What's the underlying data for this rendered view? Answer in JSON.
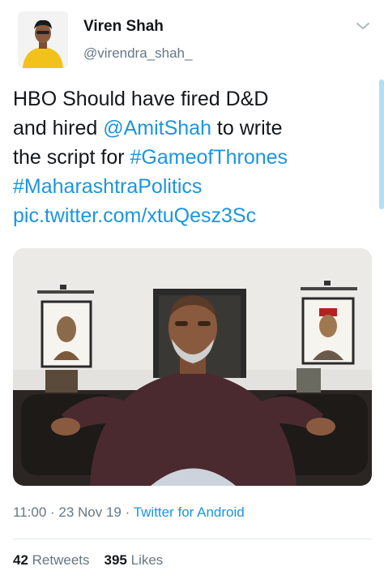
{
  "author": {
    "name": "Viren Shah",
    "handle": "@virendra_shah_"
  },
  "tweet": {
    "line1": "HBO Should have fired D&D",
    "line2_prefix": "and hired ",
    "mention": "@AmitShah",
    "line2_suffix": " to write",
    "line3_prefix": "the script for ",
    "hashtag1": "#GameofThrones",
    "hashtag2": "#MaharashtraPolitics",
    "pic_link": "pic.twitter.com/xtuQesz3Sc"
  },
  "meta": {
    "time": "11:00",
    "sep1": " · ",
    "date": "23 Nov 19",
    "sep2": " · ",
    "source": "Twitter for Android"
  },
  "stats": {
    "retweets_count": "42",
    "retweets_label": " Retweets",
    "likes_count": "395",
    "likes_label": " Likes"
  },
  "icons": {
    "chevron": "chevron-down-icon"
  },
  "colors": {
    "link": "#1b95e0",
    "secondary_text": "#657786",
    "primary_text": "#14171a"
  }
}
